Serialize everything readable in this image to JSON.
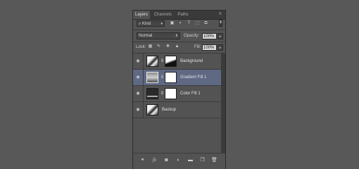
{
  "tabs": [
    "Layers",
    "Channels",
    "Paths"
  ],
  "filter": {
    "kind_label": "Kind",
    "icons": [
      "image-filter-icon",
      "adjustment-filter-icon",
      "type-filter-icon",
      "shape-filter-icon",
      "smart-object-filter-icon"
    ]
  },
  "blend": {
    "mode": "Normal",
    "opacity_label": "Opacity:",
    "opacity_value": "100%"
  },
  "lock": {
    "label": "Lock:",
    "fill_label": "Fill:",
    "fill_value": "100%"
  },
  "layers": [
    {
      "name": "Background",
      "selected": false,
      "has_mask": true
    },
    {
      "name": "Gradient Fill 1",
      "selected": true,
      "has_mask": true
    },
    {
      "name": "Color Fill 1",
      "selected": false,
      "has_mask": true
    },
    {
      "name": "Backup",
      "selected": false,
      "has_mask": false
    }
  ],
  "footer_icons": [
    "link-layers-icon",
    "fx-icon",
    "add-mask-icon",
    "new-adjustment-icon",
    "new-group-icon",
    "new-layer-icon",
    "delete-layer-icon"
  ],
  "fx_label": "fx",
  "colors": {
    "selected_row": "#5f6984",
    "panel_bg": "#535353",
    "canvas_bg": "#585858"
  }
}
